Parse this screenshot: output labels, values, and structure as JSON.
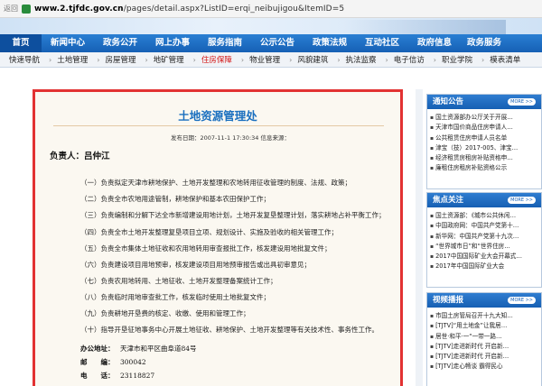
{
  "browser": {
    "back_label": "返回",
    "url_prefix": "www.2.tjfdc.gov.cn",
    "url_rest": "/pages/detail.aspx?ListID=erqi_neibujigou&ItemID=5"
  },
  "main_nav": [
    "首页",
    "新闻中心",
    "政务公开",
    "网上办事",
    "服务指南",
    "公示公告",
    "政策法规",
    "互动社区",
    "政府信息",
    "政务服务"
  ],
  "sub_nav": {
    "label": "快速导航",
    "items": [
      "土地管理",
      "房屋管理",
      "地矿管理",
      "住房保障",
      "物业管理",
      "风貌建筑",
      "执法监察",
      "电子信访",
      "职业学院",
      "模表清单"
    ],
    "active_index": 3
  },
  "article": {
    "title": "土地资源管理处",
    "meta": "发布日期：2007-11-1 17:30:34   信息来源：",
    "person": "负责人：吕仲江",
    "duties": [
      "（一）负责拟定天津市耕地保护、土地开发整理和农地转用征收管理的制度、法规、政策；",
      "（二）负责全市农地用途管制，耕地保护和基本农田保护工作；",
      "（三）负责编制和分解下达全市新增建设用地计划，土地开发复垦整理计划，落实耕地占补平衡工作；",
      "（四）负责全市土地开发整理复垦项目立项、规划设计、实施及验收的相关管理工作；",
      "（五）负责全市集体土地征收和农用地转用审查报批工作，核发建设用地批复文件；",
      "（六）负责建设项目用地预审，核发建设项目用地预审报告或出具初审意见；",
      "（七）负责农用地转用、土地征收、土地开发整理备案统计工作；",
      "（八）负责临时用地审查批工作，核发临时使用土地批复文件；",
      "（九）负责耕地开垦费的核定、收缴、使用和管理工作；",
      "（十）指导开垦征地事务中心开展土地征收、耕地保护、土地开发整理等有关技术性、事务性工作。"
    ],
    "address_label": "办公地址：",
    "address": "天津市和平区曲阜道84号",
    "postcode_label": "邮　　编：",
    "postcode": "300042",
    "phone_label": "电　　话：",
    "phone": "23118827"
  },
  "sidebar": {
    "notices": {
      "title": "通知公告",
      "more": "MORE >>",
      "items": [
        "国土资源部办公厅关于开展…",
        "天津市国价商品住房申请人…",
        "公共租赁住房申请人员名单",
        "津宝（技）2017-005、津宝…",
        "经济租赁房租房补贴资格申…",
        "廉租住房租房补贴资格公示"
      ]
    },
    "focus": {
      "title": "焦点关注",
      "more": "MORE >>",
      "items": [
        "国土资源部：《城市公共休闲…",
        "中国政府网：中国共产党第十…",
        "新华网：中国共产党第十九次…",
        "“世界城市日”和“世界住房…",
        "2017中国国际矿业大会开幕式…",
        "2017年中国国际矿业大会"
      ]
    },
    "videos": {
      "title": "视频播报",
      "more": "MORE >>",
      "items": [
        "市国土房管局召开十九大知…",
        "[TJTV]“用土地金”让我居…",
        "居世·和平·一“一带一路…",
        "[TJTV]走进新时代 开启新…",
        "[TJTV]走进新时代 开启新…",
        "[TJTV]走心畅谈 霸得民心"
      ]
    }
  }
}
